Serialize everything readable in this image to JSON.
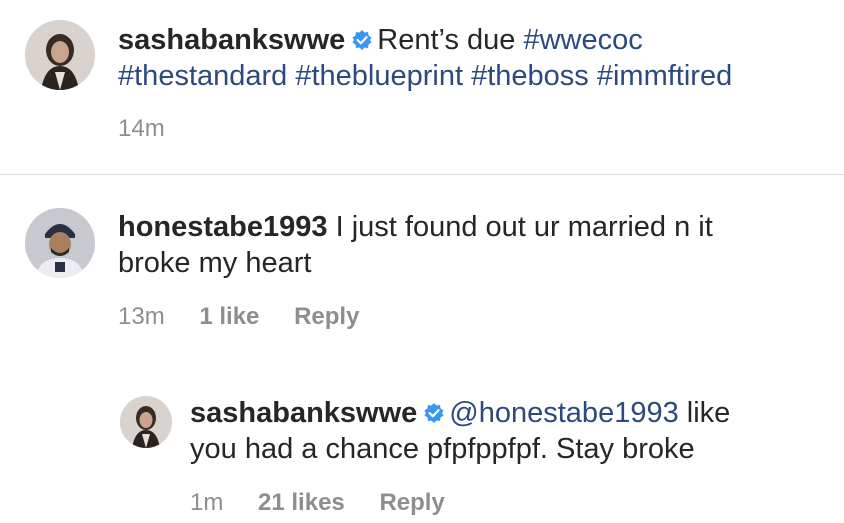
{
  "post": {
    "username": "sashabankswwe",
    "text_pre": "Rent’s due",
    "tags_line1": "#wwecoc",
    "tags_line2": "#thestandard #theblueprint #theboss #immftired",
    "time": "14m"
  },
  "comment": {
    "username": "honestabe1993",
    "text_line1": "I just found out ur married n it",
    "text_line2": "broke my heart",
    "time": "13m",
    "likes": "1 like",
    "reply": "Reply"
  },
  "reply": {
    "username": "sashabankswwe",
    "mention": "@honestabe1993",
    "text_line1_tail": "like",
    "text_line2": "you had a chance pfpfppfpf. Stay broke",
    "time": "1m",
    "likes": "21 likes",
    "reply": "Reply"
  },
  "icons": {
    "verified": "verified-badge-icon",
    "avatar_post": "profile-photo",
    "avatar_comment": "profile-photo",
    "avatar_reply": "profile-photo"
  },
  "colors": {
    "hashtag": "#2b4a7e",
    "meta": "#8e8e8e",
    "verified": "#3897f0"
  }
}
